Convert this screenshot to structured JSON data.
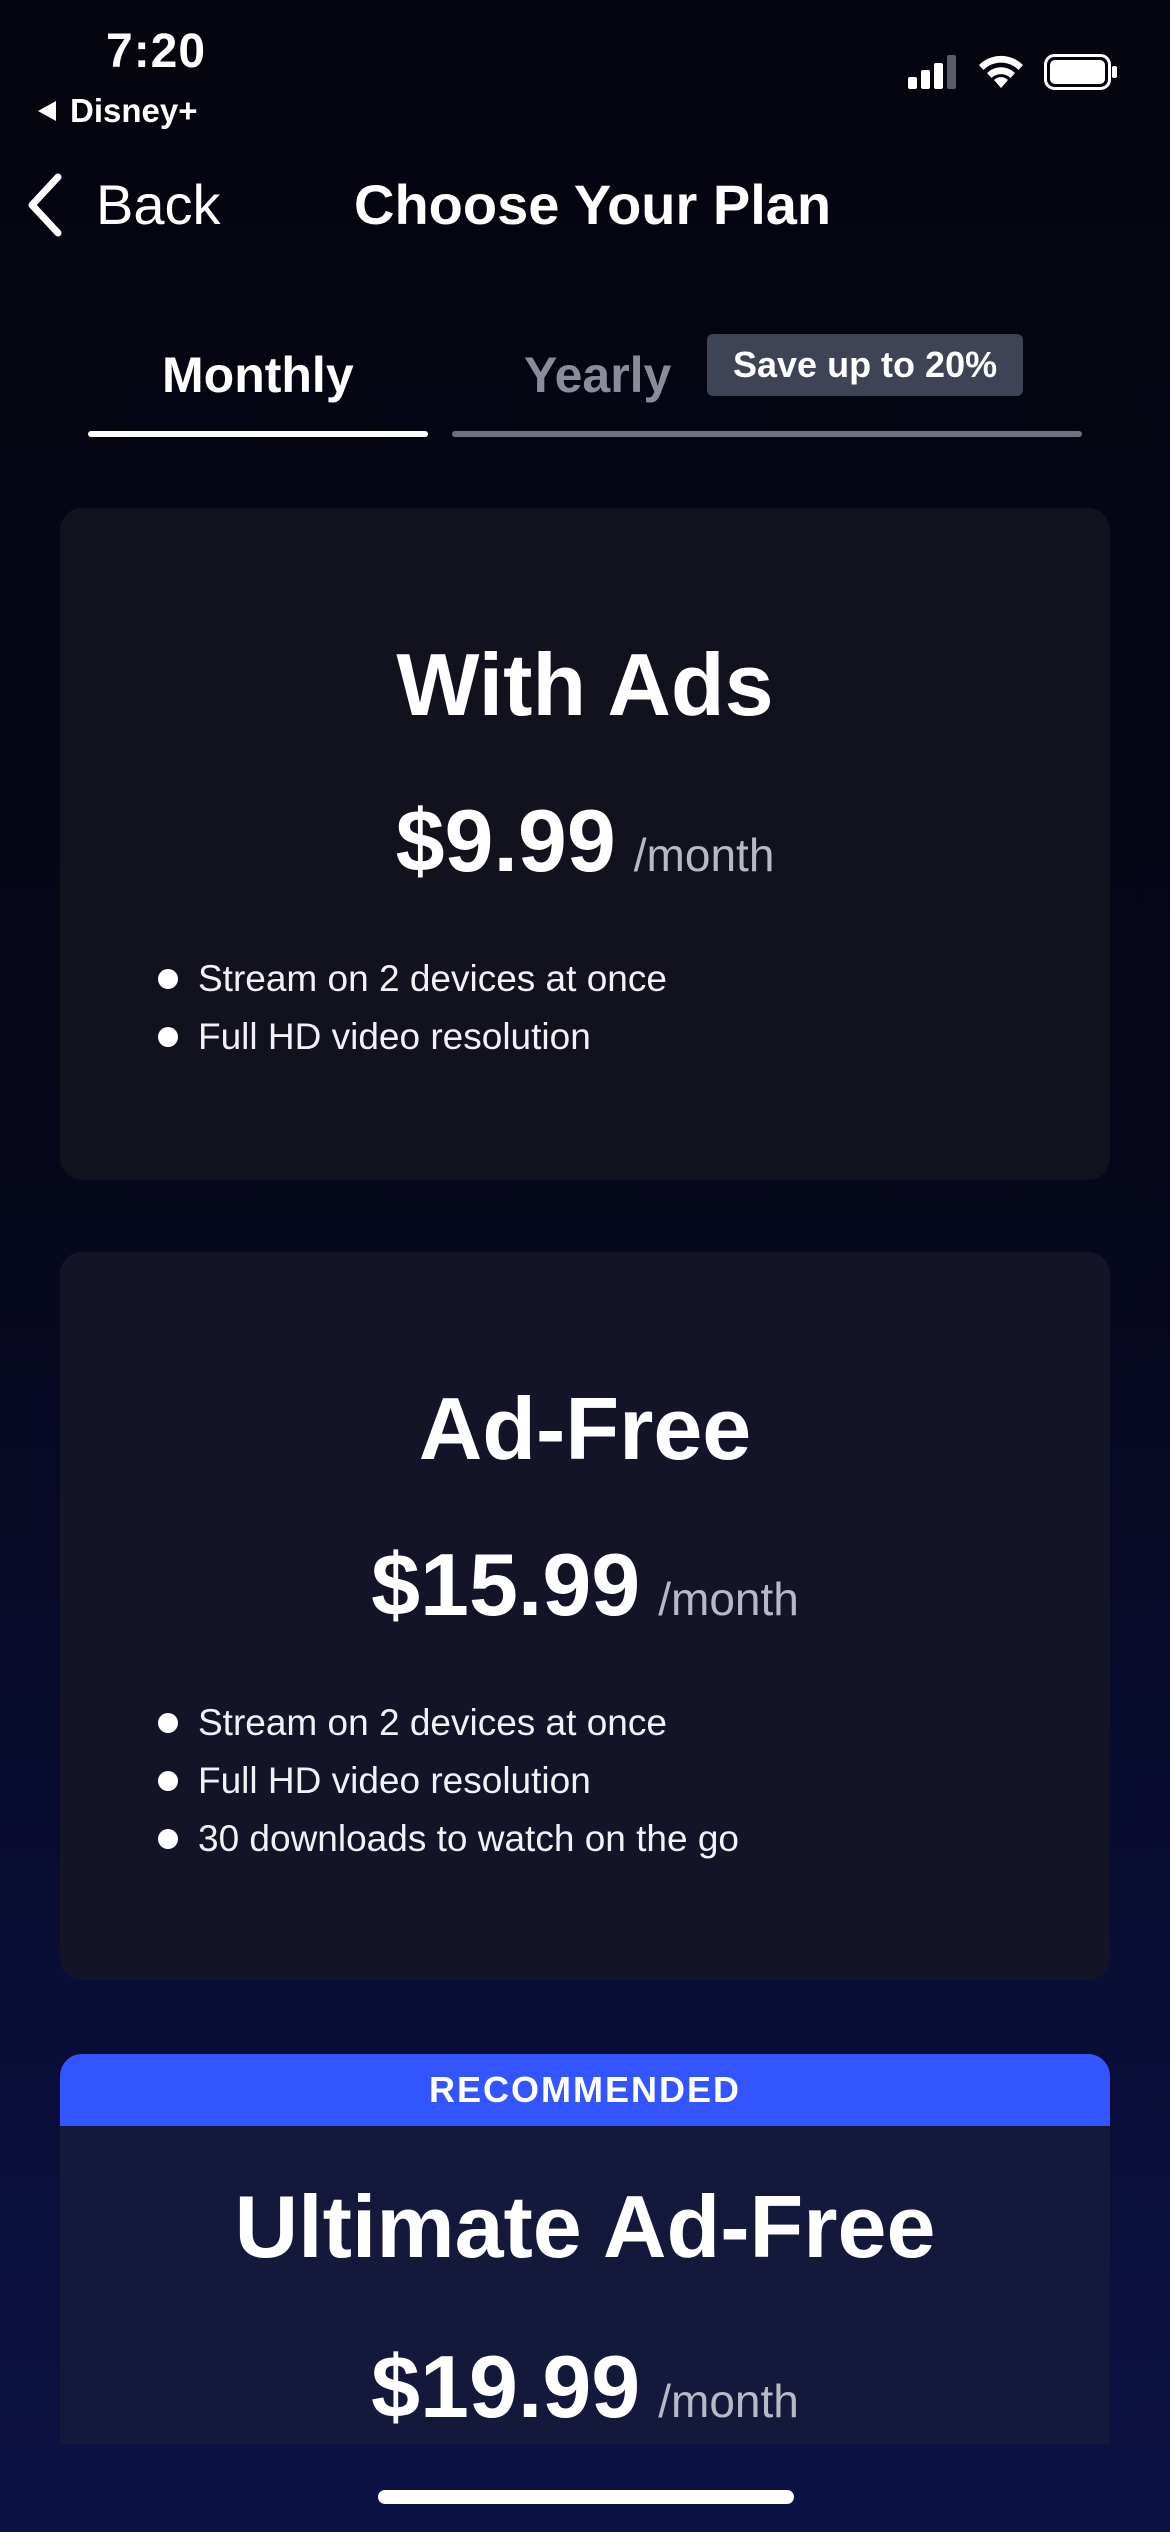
{
  "status_bar": {
    "time": "7:20",
    "back_app": "Disney+",
    "icons": [
      "cellular-signal-icon",
      "wifi-icon",
      "battery-icon"
    ]
  },
  "nav": {
    "back_label": "Back",
    "title": "Choose Your Plan"
  },
  "tabs": {
    "monthly_label": "Monthly",
    "yearly_label": "Yearly",
    "selected": "Monthly",
    "yearly_badge": "Save up to 20%"
  },
  "plans": [
    {
      "name": "With Ads",
      "price": "$9.99",
      "period": "/month",
      "features": [
        "Stream on 2 devices at once",
        "Full HD video resolution"
      ]
    },
    {
      "name": "Ad-Free",
      "price": "$15.99",
      "period": "/month",
      "features": [
        "Stream on 2 devices at once",
        "Full HD video resolution",
        "30 downloads to watch on the go"
      ]
    },
    {
      "badge": "RECOMMENDED",
      "name": "Ultimate Ad-Free",
      "price": "$19.99",
      "period": "/month"
    }
  ],
  "colors": {
    "accent": "#3355ff",
    "background": "#05050f",
    "card": "#12121f",
    "badge_bg": "#3f4356"
  }
}
